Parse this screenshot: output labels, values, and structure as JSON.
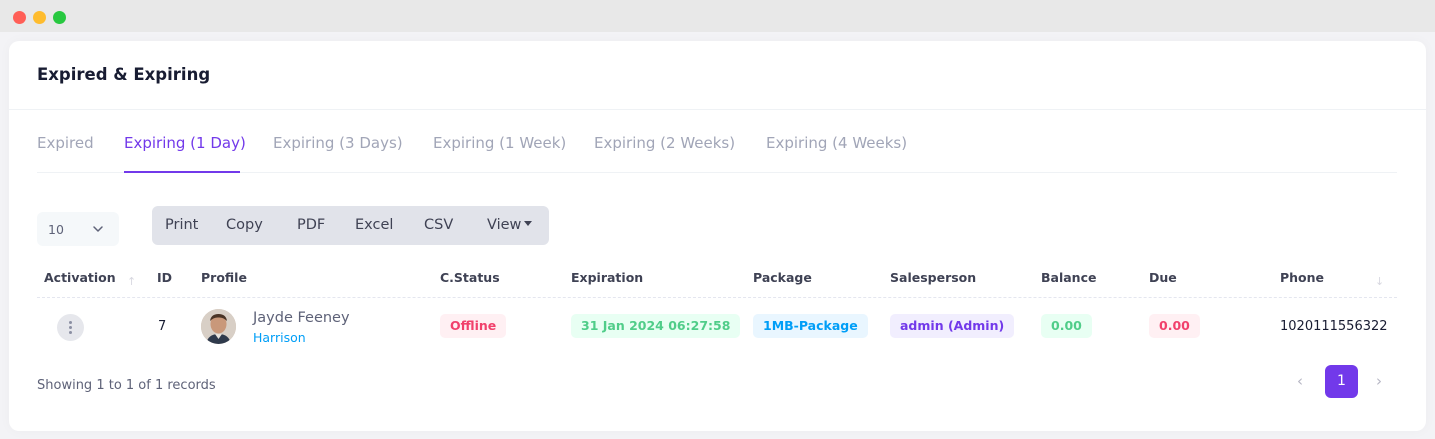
{
  "window": {
    "controls": [
      "close",
      "minimize",
      "zoom"
    ]
  },
  "card": {
    "title": "Expired & Expiring"
  },
  "tabs": [
    {
      "label": "Expired",
      "active": false
    },
    {
      "label": "Expiring (1 Day)",
      "active": true
    },
    {
      "label": "Expiring (3 Days)",
      "active": false
    },
    {
      "label": "Expiring (1 Week)",
      "active": false
    },
    {
      "label": "Expiring (2 Weeks)",
      "active": false
    },
    {
      "label": "Expiring (4 Weeks)",
      "active": false
    }
  ],
  "length_select": {
    "value": "10",
    "icon": "chevron-down-icon"
  },
  "toolbar": {
    "buttons": [
      "Print",
      "Copy",
      "PDF",
      "Excel",
      "CSV"
    ],
    "view_label": "View"
  },
  "table": {
    "columns": [
      "Activation",
      "ID",
      "Profile",
      "C.Status",
      "Expiration",
      "Package",
      "Salesperson",
      "Balance",
      "Due",
      "Phone"
    ],
    "rows": [
      {
        "activation_icon": "kebab-menu-icon",
        "id": "7",
        "profile_name": "Jayde Feeney",
        "profile_sub": "Harrison",
        "status": "Offline",
        "expiration": "31 Jan 2024 06:27:58",
        "package": "1MB-Package",
        "salesperson": "admin (Admin)",
        "balance": "0.00",
        "due": "0.00",
        "phone": "1020111556322"
      }
    ]
  },
  "footer": {
    "info": "Showing 1 to 1 of 1 records",
    "pagination": {
      "prev_icon": "chevron-left-icon",
      "pages": [
        "1"
      ],
      "current": "1",
      "next_icon": "chevron-right-icon"
    }
  },
  "colors": {
    "accent": "#7239ea",
    "danger": "#f1416c",
    "success": "#50cd89",
    "info": "#009ef7"
  }
}
